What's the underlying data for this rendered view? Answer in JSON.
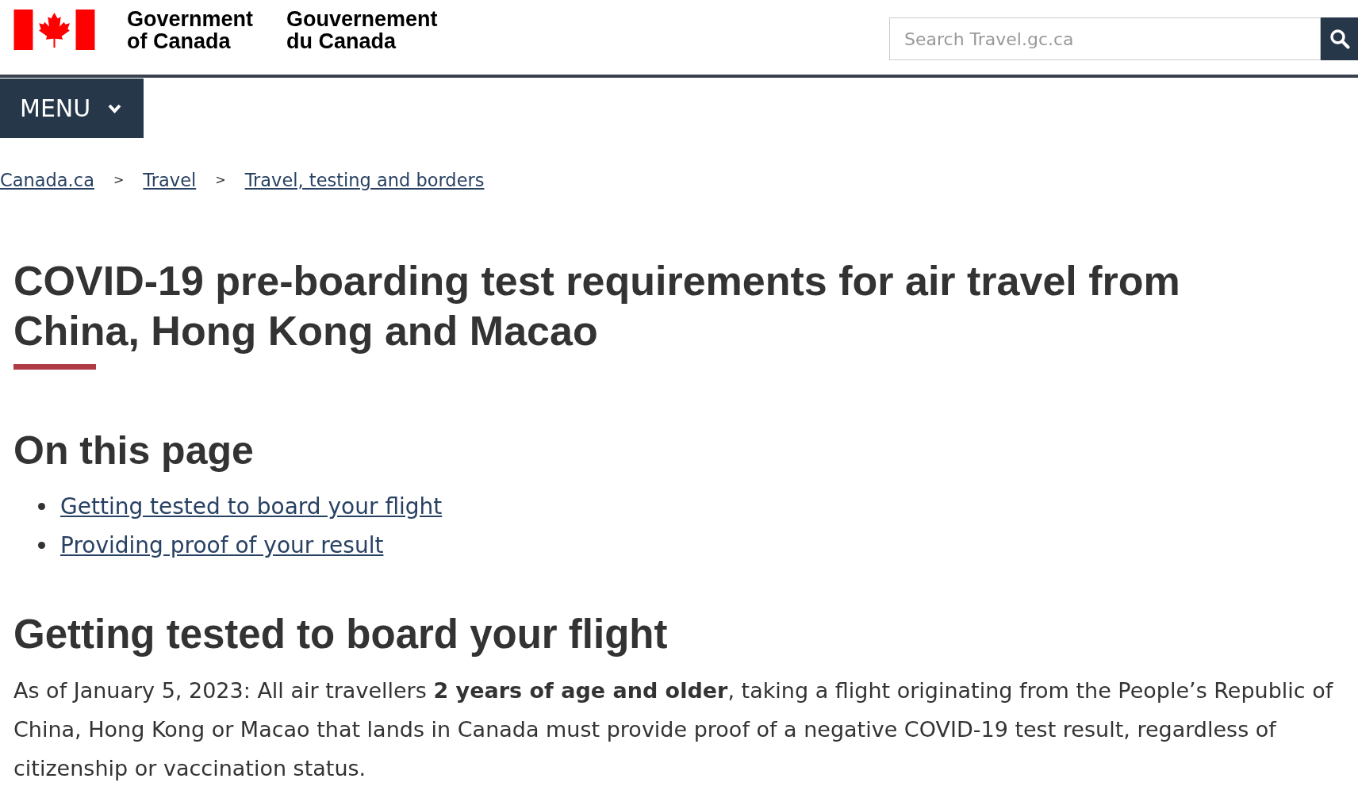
{
  "header": {
    "wordmark_english": [
      "Government",
      "of Canada"
    ],
    "wordmark_french": [
      "Gouvernement",
      "du Canada"
    ],
    "search": {
      "placeholder": "Search Travel.gc.ca"
    }
  },
  "menu_button": {
    "label": "MENU",
    "expanded": false
  },
  "breadcrumb": {
    "items": [
      {
        "label": "Canada.ca"
      },
      {
        "separator": ">",
        "label": "Travel"
      },
      {
        "separator": ">",
        "label": "Travel, testing and borders"
      }
    ]
  },
  "title": "COVID-19 pre-boarding test requirements for air travel from China, Hong Kong and Macao",
  "on_this_page": {
    "heading": "On this page",
    "links": [
      "Getting tested to board your flight",
      "Providing proof of your result"
    ]
  },
  "sections": [
    {
      "heading": "Getting tested to board your flight",
      "paragraphs": [
        "As of January 5, 2023: All air travellers **2 years of age and older**, taking a flight originating from the People’s Republic of China, Hong Kong or Macao that lands in Canada must provide proof of a negative COVID-19 test result, regardless of citizenship or vaccination status."
      ]
    }
  ]
}
